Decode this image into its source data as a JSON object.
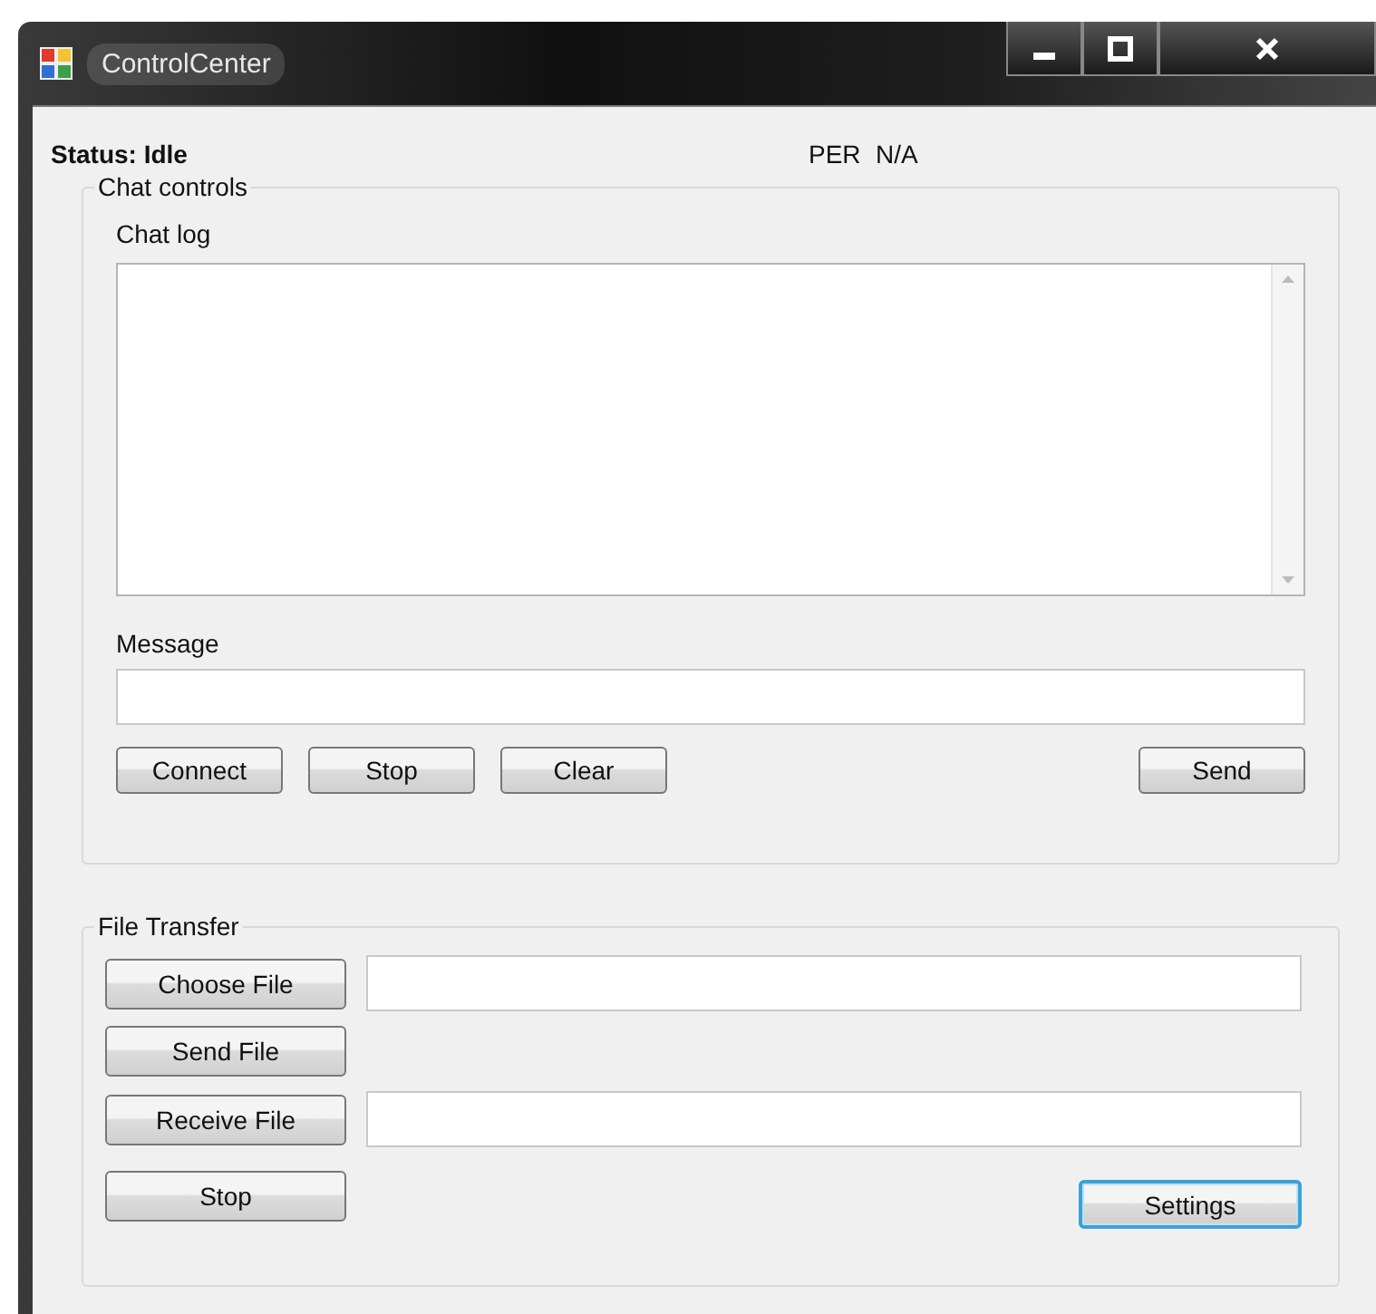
{
  "window": {
    "title": "ControlCenter"
  },
  "status": {
    "label": "Status: Idle"
  },
  "per": {
    "label": "PER",
    "value": "N/A"
  },
  "chat": {
    "title": "Chat controls",
    "log_label": "Chat log",
    "message_label": "Message",
    "buttons": [
      {
        "label": "Connect",
        "focused": false
      },
      {
        "label": "Stop",
        "focused": false
      },
      {
        "label": "Clear",
        "focused": false
      },
      {
        "label": "Send",
        "focused": false
      }
    ]
  },
  "file_transfer": {
    "title": "File Transfer",
    "buttons": [
      {
        "label": "Choose File",
        "focused": false
      },
      {
        "label": "Send File",
        "focused": false
      },
      {
        "label": "Receive File",
        "focused": false
      },
      {
        "label": "Stop",
        "focused": false
      },
      {
        "label": "Settings",
        "focused": true
      }
    ]
  }
}
